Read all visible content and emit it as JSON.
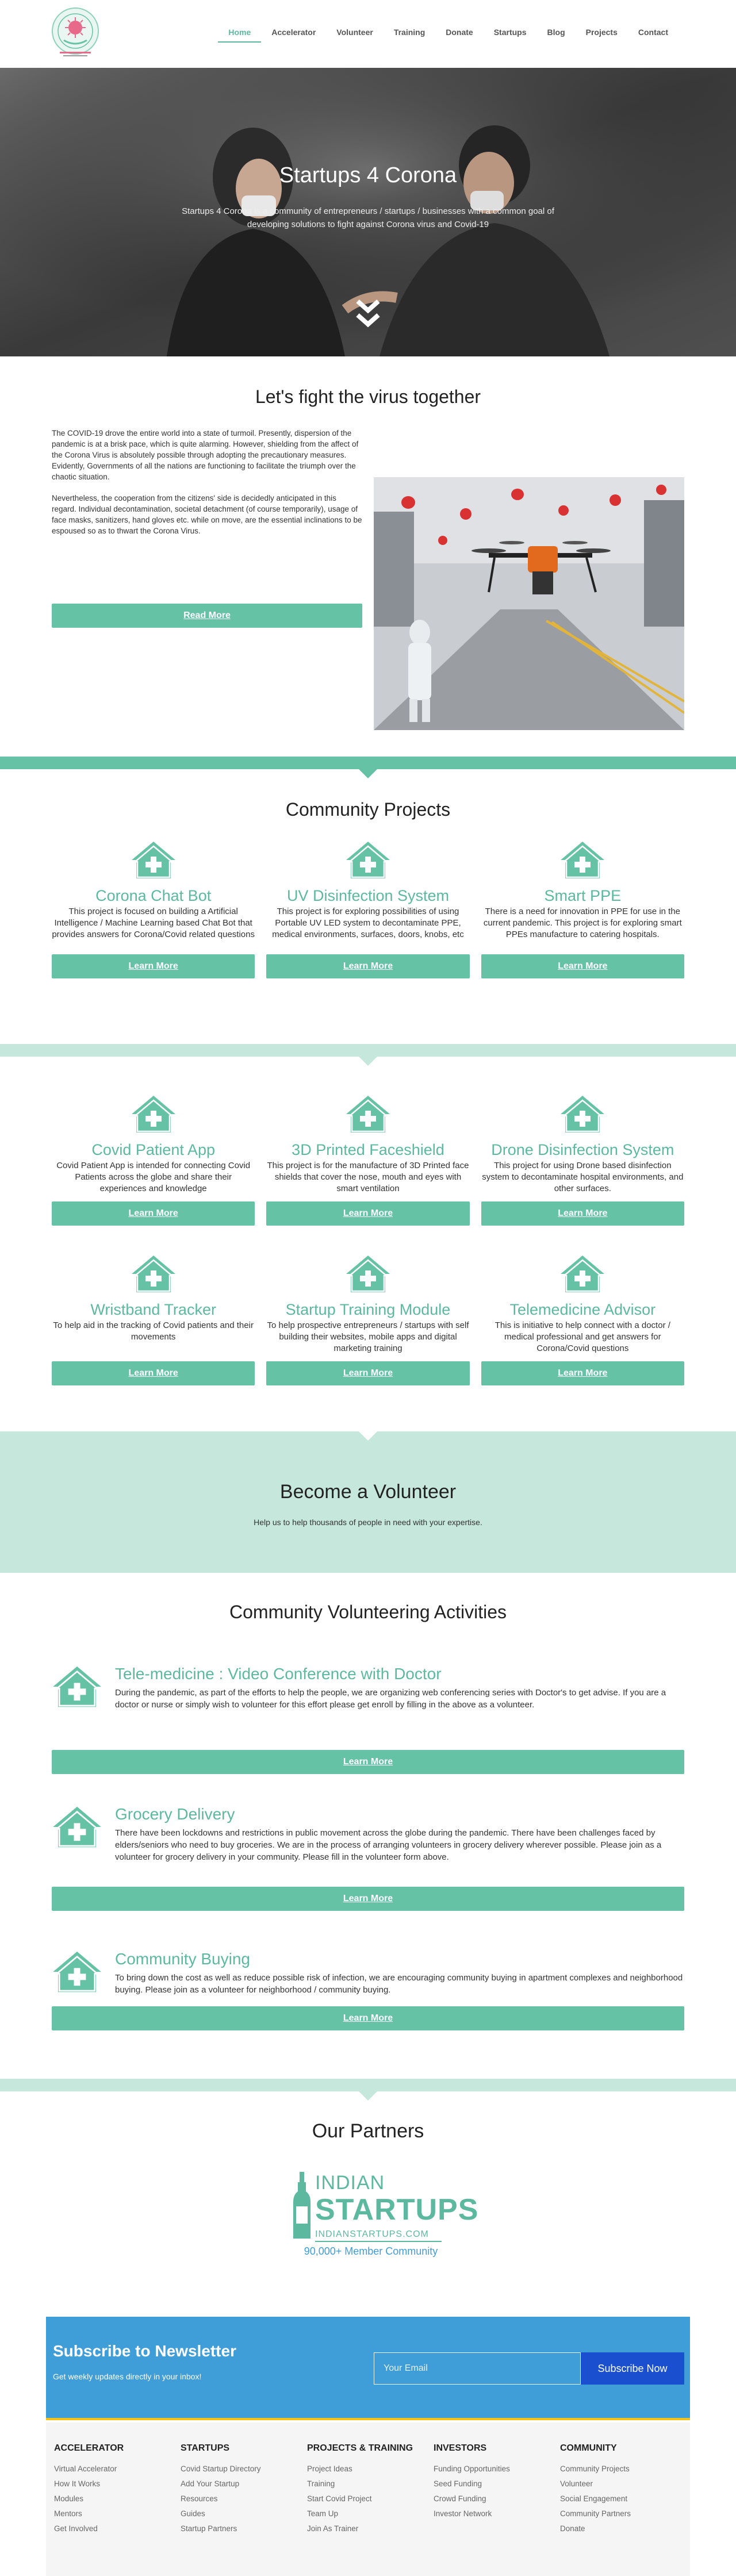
{
  "nav": {
    "items": [
      {
        "label": "Home",
        "active": true
      },
      {
        "label": "Accelerator"
      },
      {
        "label": "Volunteer"
      },
      {
        "label": "Training"
      },
      {
        "label": "Donate"
      },
      {
        "label": "Startups"
      },
      {
        "label": "Blog"
      },
      {
        "label": "Projects"
      },
      {
        "label": "Contact"
      }
    ]
  },
  "hero": {
    "title": "Startups 4 Corona",
    "text": "Startups 4 Corona is a community of entrepreneurs / startups / businesses with a common goal of developing solutions to fight against Corona virus and Covid-19",
    "scroll_icon": "double-chevron-down-icon"
  },
  "fight": {
    "title": "Let's fight the virus together",
    "p1": "The COVID-19 drove the entire world into a state of turmoil. Presently, dispersion of the pandemic is at a brisk pace, which is quite alarming. However, shielding from the affect of the Corona Virus is absolutely possible through adopting the precautionary measures. Evidently, Governments of all the nations are functioning to facilitate the triumph over the chaotic situation.",
    "p2": "Nevertheless, the cooperation from the citizens' side is decidedly anticipated in this regard. Individual decontamination, societal detachment (of course temporarily), usage of face masks, sanitizers, hand gloves etc. while on move, are the essential inclinations to be espoused so as to thwart the Corona Virus.",
    "button": "Read More"
  },
  "projects": {
    "title": "Community Projects",
    "button": "Learn More",
    "row1": [
      {
        "title": "Corona Chat Bot",
        "text": "This project is focused on building a Artificial Intelligence / Machine Learning based Chat Bot that provides answers for Corona/Covid related questions"
      },
      {
        "title": "UV Disinfection System",
        "text": "This project is for exploring possibilities of using Portable UV LED system to decontaminate PPE, medical environments, surfaces, doors, knobs, etc"
      },
      {
        "title": "Smart PPE",
        "text": "There is a need for innovation in PPE for use in the current pandemic. This project is for exploring smart PPEs manufacture to catering hospitals."
      }
    ],
    "row2": [
      {
        "title": "Covid Patient App",
        "text": "Covid Patient App is intended for connecting Covid Patients across the globe and share their experiences and knowledge"
      },
      {
        "title": "3D Printed Faceshield",
        "text": "This project is for the manufacture of 3D Printed face shields that cover the nose, mouth and eyes with smart ventilation"
      },
      {
        "title": "Drone Disinfection System",
        "text": "This project for using Drone based disinfection system to decontaminate hospital environments, and other surfaces."
      }
    ],
    "row3": [
      {
        "title": "Wristband Tracker",
        "text": "To help aid in the tracking of Covid patients and their movements"
      },
      {
        "title": "Startup Training Module",
        "text": "To help prospective entrepreneurs / startups with self building their websites, mobile apps and digital marketing training"
      },
      {
        "title": "Telemedicine Advisor",
        "text": "This is initiative to help connect with a doctor / medical professional and get answers for Corona/Covid questions"
      }
    ]
  },
  "volunteer": {
    "title": "Become a Volunteer",
    "text": "Help us to help thousands of people in need with your expertise."
  },
  "activities": {
    "title": "Community Volunteering Activities",
    "button": "Learn More",
    "items": [
      {
        "title": "Tele-medicine : Video Conference with Doctor",
        "text": "During the pandemic, as part of the efforts to help the people, we are organizing web conferencing series with Doctor's to get advise. If you are a doctor or nurse or simply wish to volunteer for this effort please get enroll by filling in the above as a volunteer."
      },
      {
        "title": "Grocery Delivery",
        "text": "There have been lockdowns and restrictions in public movement across the globe during the pandemic. There have been challenges faced by elders/seniors who need to buy groceries. We are in the process of arranging volunteers in grocery delivery wherever possible. Please join as a volunteer for grocery delivery in your community. Please fill in the volunteer form above."
      },
      {
        "title": "Community Buying",
        "text": "To bring down the cost as well as reduce possible risk of infection, we are encouraging community buying in apartment complexes and neighborhood buying. Please join as a volunteer for neighborhood / community buying."
      }
    ]
  },
  "partners": {
    "title": "Our Partners",
    "logo_line1": "INDIAN",
    "logo_line2": "STARTUPS",
    "logo_url": "INDIANSTARTUPS.COM",
    "logo_members": "90,000+ Member Community"
  },
  "subscribe": {
    "title": "Subscribe to Newsletter",
    "text": "Get weekly updates directly in your inbox!",
    "placeholder": "Your Email",
    "button": "Subscribe Now"
  },
  "footer": {
    "cols": [
      {
        "title": "ACCELERATOR",
        "items": [
          "Virtual Accelerator",
          "How It Works",
          "Modules",
          "Mentors",
          "Get Involved"
        ]
      },
      {
        "title": "STARTUPS",
        "items": [
          "Covid Startup Directory",
          "Add Your Startup",
          "Resources",
          "Guides",
          "Startup Partners"
        ]
      },
      {
        "title": "PROJECTS & TRAINING",
        "items": [
          "Project Ideas",
          "Training",
          "Start Covid Project",
          "Team Up",
          "Join As Trainer"
        ]
      },
      {
        "title": "INVESTORS",
        "items": [
          "Funding Opportunities",
          "Seed Funding",
          "Crowd Funding",
          "Investor Network"
        ]
      },
      {
        "title": "COMMUNITY",
        "items": [
          "Community Projects",
          "Volunteer",
          "Social Engagement",
          "Community Partners",
          "Donate"
        ]
      }
    ]
  },
  "colors": {
    "accent": "#66c2a5",
    "accent_light": "#c6e8dc",
    "subscribe_bg": "#3f9ed8",
    "subscribe_button": "#1a4fd0"
  }
}
